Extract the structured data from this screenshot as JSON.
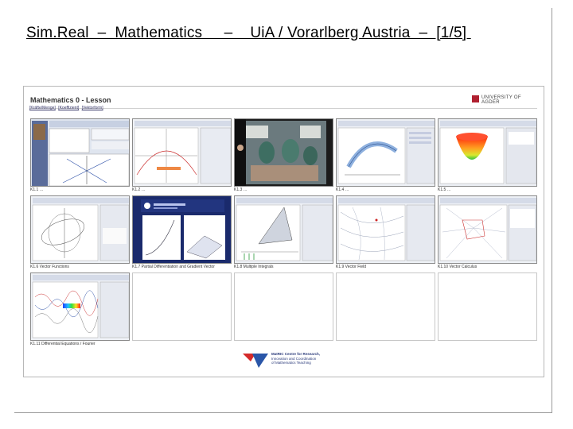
{
  "slide": {
    "title": "Sim.Real  –  Mathematics     –    UiA / Vorarlberg Austria  –  [1/5] "
  },
  "page": {
    "lesson_title": "Mathematics 0 - Lesson",
    "university_logo_text": "UNIVERSITY OF AGDER",
    "breadcrumbs": [
      "[Kräfte/Menge]",
      "[Koeffizient]",
      "[Vektorform]"
    ]
  },
  "thumbnails": [
    {
      "caption": "K1.1 …"
    },
    {
      "caption": "K1.2 …"
    },
    {
      "caption": "K1.3 …"
    },
    {
      "caption": "K1.4 …"
    },
    {
      "caption": "K1.5 …"
    },
    {
      "caption": "K1.6 Vector Functions"
    },
    {
      "caption": "K1.7 Partial Differentiation and Gradient Vector"
    },
    {
      "caption": "K1.8 Multiple Integrals"
    },
    {
      "caption": "K1.9 Vector Field"
    },
    {
      "caption": "K1.10 Vector Calculus"
    },
    {
      "caption": "K1.11 Differential Equations / Fourier"
    }
  ],
  "footer": {
    "logo_lines": [
      "MatRIC Centre for Research,",
      "Innovation and Coordination",
      "of Mathematics Teaching"
    ],
    "colors": {
      "red": "#d42a2a",
      "blue": "#2a56a8"
    }
  }
}
